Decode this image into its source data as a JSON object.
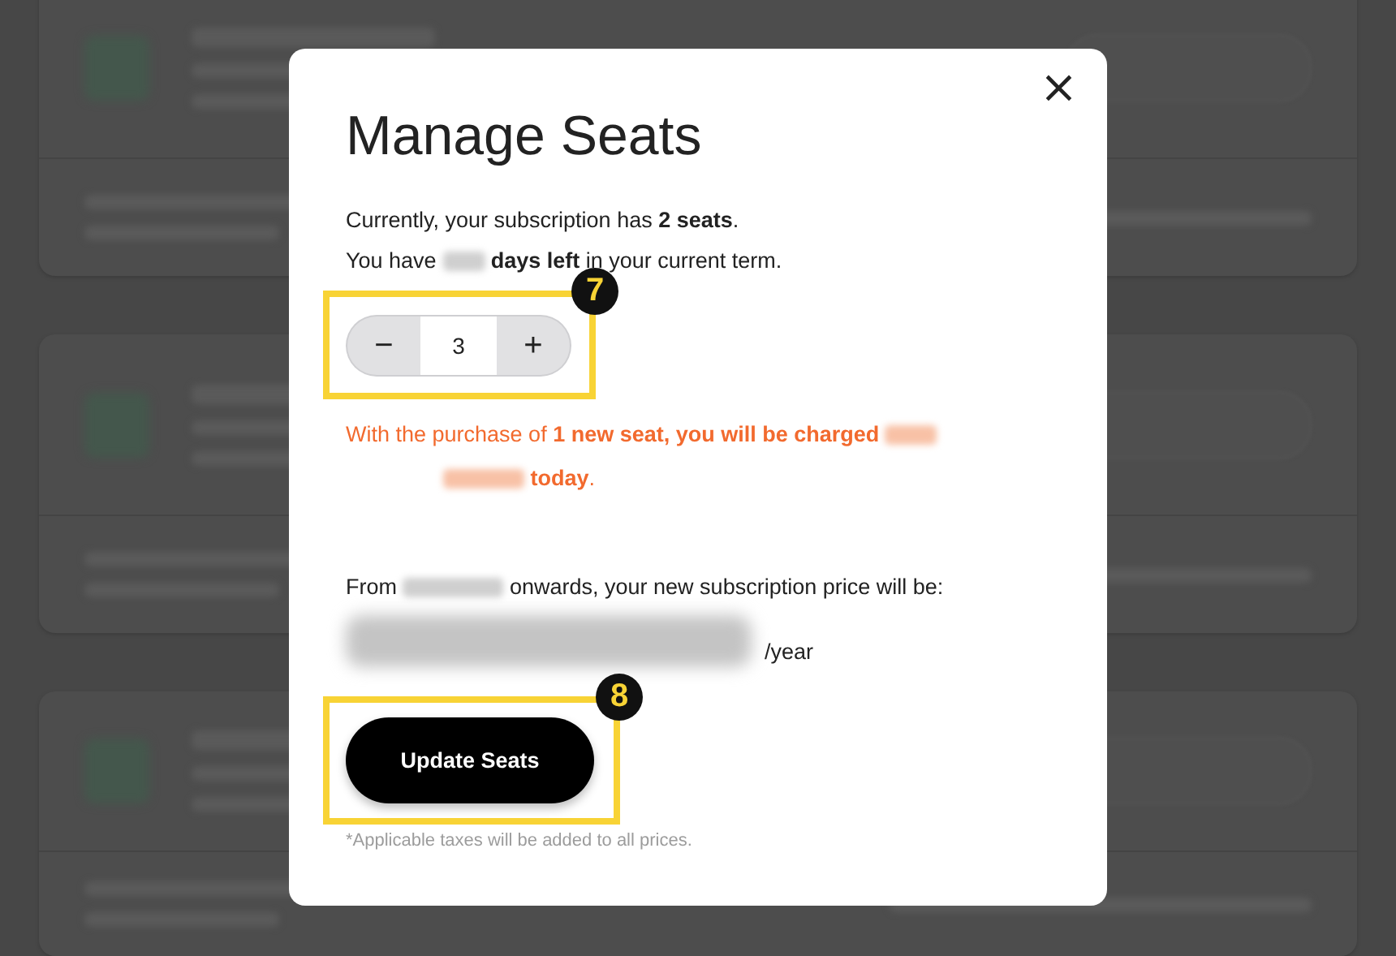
{
  "dialog": {
    "title": "Manage Seats",
    "close": "×",
    "lines": [
      {
        "parts": [
          {
            "kind": "text",
            "text": "Currently, your subscription has **2 seats**."
          }
        ]
      },
      {
        "parts": [
          {
            "kind": "text",
            "text": "You have "
          },
          {
            "kind": "redacted"
          },
          {
            "kind": "text",
            "text": " **days left** in your current term."
          }
        ]
      }
    ],
    "stepper": {
      "minus": "−",
      "value": "3",
      "plus": "+",
      "callout": "7"
    },
    "charge": {
      "parts": [
        {
          "kind": "text",
          "text": "With the purchase of **1 new seat, you will be charged** "
        },
        {
          "kind": "redacted"
        },
        {
          "kind": "redacted"
        },
        {
          "kind": "text",
          "text": " **today**."
        }
      ]
    },
    "from": {
      "parts": [
        {
          "kind": "text",
          "text": "From "
        },
        {
          "kind": "redacted"
        },
        {
          "kind": "text",
          "text": " onwards, your new subscription price will be:"
        }
      ]
    },
    "price": {
      "suffix": "/year"
    },
    "button": {
      "label": "Update Seats",
      "callout": "8"
    },
    "footnote": "*Applicable taxes will be added to all prices."
  }
}
